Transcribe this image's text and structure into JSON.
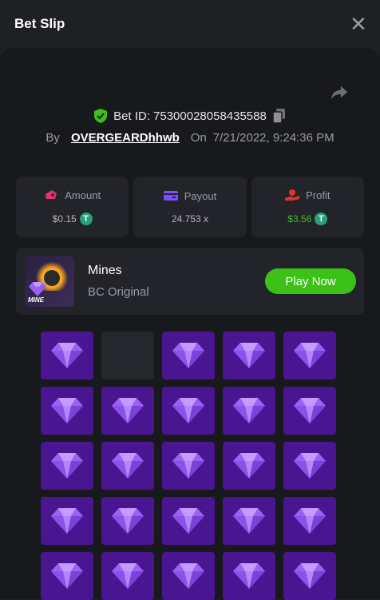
{
  "header": {
    "title": "Bet Slip",
    "close_glyph": "✕"
  },
  "bet": {
    "id_label": "Bet ID:",
    "id_value": "75300028058435588",
    "by_label": "By",
    "username": "OVERGEARDhhwb",
    "on_label": "On",
    "datetime": "7/21/2022, 9:24:36 PM"
  },
  "stats": [
    {
      "label": "Amount",
      "icon": "wallet-icon",
      "icon_color": "#e0356b",
      "value": "$0.15",
      "coin": true,
      "value_color": "normal"
    },
    {
      "label": "Payout",
      "icon": "card-icon",
      "icon_color": "#7b4dff",
      "value": "24.753 x",
      "coin": false,
      "value_color": "normal"
    },
    {
      "label": "Profit",
      "icon": "hand-coin-icon",
      "icon_color": "#e0352b",
      "value": "$3.56",
      "coin": true,
      "value_color": "green"
    }
  ],
  "coin_symbol": "T",
  "game": {
    "name": "Mines",
    "subtitle": "BC Original",
    "thumb_label": "MINE",
    "play_label": "Play Now"
  },
  "grid": {
    "columns": 5,
    "tiles": [
      "gem",
      "empty",
      "gem",
      "gem",
      "gem",
      "gem",
      "gem",
      "gem",
      "gem",
      "gem",
      "gem",
      "gem",
      "gem",
      "gem",
      "gem",
      "gem",
      "gem",
      "gem",
      "gem",
      "gem",
      "gem",
      "gem",
      "gem",
      "gem",
      "gem"
    ]
  },
  "colors": {
    "accent_green": "#3bc117",
    "tile_purple": "#4a1590",
    "gem_light": "#c49bff",
    "gem_mid": "#9a62f2",
    "gem_dark": "#7a42d8",
    "shield_green": "#3bc117"
  }
}
